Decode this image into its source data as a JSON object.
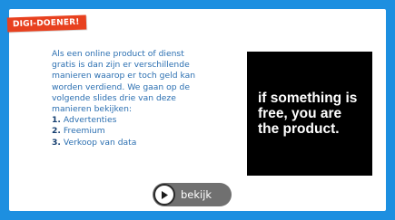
{
  "badge": {
    "label": "DIGI-DOENER!"
  },
  "intro": {
    "lines": [
      "Als een online product of dienst",
      "gratis is dan zijn er verschillende",
      "manieren waarop er toch geld kan",
      "worden verdiend. We gaan op de",
      "volgende slides drie van deze",
      "manieren bekijken:"
    ],
    "list": [
      {
        "num": "1.",
        "label": "Advertenties"
      },
      {
        "num": "2.",
        "label": "Freemium"
      },
      {
        "num": "3.",
        "label": "Verkoop van data"
      }
    ]
  },
  "quote": {
    "lines": [
      "if something is",
      "free, you are",
      "the product."
    ]
  },
  "play": {
    "label": "bekijk",
    "icon": "play-icon"
  },
  "colors": {
    "frame": "#1d8fe0",
    "badge": "#e8411f",
    "text": "#2b6fb1",
    "quote_bg": "#000000",
    "button": "#707070"
  }
}
